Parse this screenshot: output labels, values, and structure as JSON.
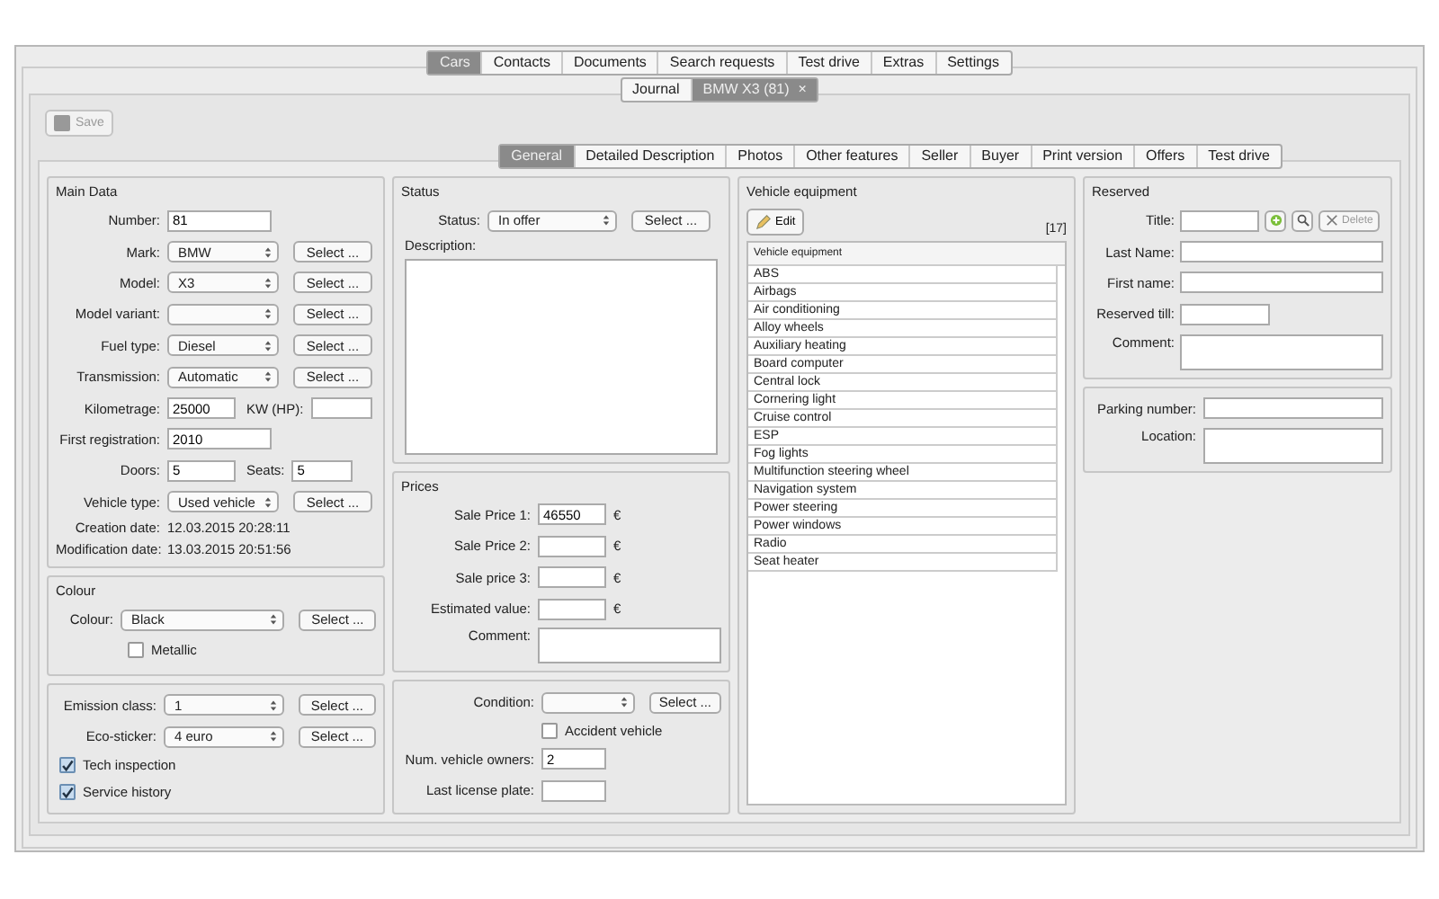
{
  "main_tabs": [
    {
      "label": "Cars",
      "selected": true
    },
    {
      "label": "Contacts",
      "selected": false
    },
    {
      "label": "Documents",
      "selected": false
    },
    {
      "label": "Search requests",
      "selected": false
    },
    {
      "label": "Test drive",
      "selected": false
    },
    {
      "label": "Extras",
      "selected": false
    },
    {
      "label": "Settings",
      "selected": false
    }
  ],
  "document_tabs": [
    {
      "label": "Journal",
      "selected": false
    },
    {
      "label": "BMW X3 (81)",
      "selected": true,
      "close": "×"
    }
  ],
  "save_button": {
    "label": "Save",
    "disabled": true
  },
  "section_tabs": [
    {
      "label": "General",
      "selected": true
    },
    {
      "label": "Detailed Description",
      "selected": false
    },
    {
      "label": "Photos",
      "selected": false
    },
    {
      "label": "Other features",
      "selected": false
    },
    {
      "label": "Seller",
      "selected": false
    },
    {
      "label": "Buyer",
      "selected": false
    },
    {
      "label": "Print version",
      "selected": false
    },
    {
      "label": "Offers",
      "selected": false
    },
    {
      "label": "Test drive",
      "selected": false
    }
  ],
  "main_data": {
    "title": "Main Data",
    "fields": [
      {
        "kind": "text",
        "label": "Number:",
        "value": "81"
      },
      {
        "kind": "select",
        "label": "Mark:",
        "value": "BMW",
        "button": "Select ..."
      },
      {
        "kind": "select",
        "label": "Model:",
        "value": "X3",
        "button": "Select ..."
      },
      {
        "kind": "select",
        "label": "Model variant:",
        "button": "Select ..."
      },
      {
        "kind": "select",
        "label": "Fuel type:",
        "value": "Diesel",
        "button": "Select ..."
      },
      {
        "kind": "select",
        "label": "Transmission:",
        "value": "Automatic",
        "button": "Select ..."
      },
      {
        "kind": "pair",
        "label": "Kilometrage:",
        "value": "25000",
        "label_2": "KW (HP):"
      },
      {
        "kind": "text",
        "label": "First registration:",
        "value": "2010"
      },
      {
        "kind": "pair",
        "label": "Doors:",
        "value": "5",
        "label_2": "Seats:",
        "value_2": "5"
      },
      {
        "kind": "select",
        "label": "Vehicle type:",
        "value": "Used vehicle",
        "button": "Select ..."
      },
      {
        "kind": "info",
        "label": "Creation date:",
        "value": "12.03.2015  20:28:11"
      },
      {
        "kind": "info",
        "label": "Modification date:",
        "value": "13.03.2015  20:51:56"
      }
    ]
  },
  "colour": {
    "title": "Colour",
    "fields": [
      {
        "kind": "select",
        "label": "Colour:",
        "value": "Black",
        "button": "Select ..."
      },
      {
        "kind": "checkbox",
        "label": "Metallic",
        "checked": false
      }
    ]
  },
  "emission": {
    "fields": [
      {
        "kind": "select",
        "label": "Emission class:",
        "value": "1",
        "button": "Select ..."
      },
      {
        "kind": "select",
        "label": "Eco-sticker:",
        "value": "4 euro",
        "button": "Select ..."
      },
      {
        "kind": "checkbox",
        "label": "Tech inspection",
        "checked": true
      },
      {
        "kind": "checkbox",
        "label": "Service history",
        "checked": true
      }
    ]
  },
  "status": {
    "title": "Status",
    "fields": [
      {
        "kind": "select",
        "label": "Status:",
        "value": "In offer",
        "button": "Select ..."
      },
      {
        "kind": "description",
        "label": "Description:"
      }
    ]
  },
  "prices": {
    "title": "Prices",
    "fields": [
      {
        "kind": "money",
        "label": "Sale Price 1:",
        "value": "46550",
        "unit": "€"
      },
      {
        "kind": "money",
        "label": "Sale Price 2:",
        "unit": "€"
      },
      {
        "kind": "money",
        "label": "Sale price 3:",
        "unit": "€"
      },
      {
        "kind": "money",
        "label": "Estimated value:",
        "unit": "€"
      },
      {
        "kind": "textarea",
        "label": "Comment:"
      }
    ]
  },
  "condition": {
    "fields": [
      {
        "kind": "select",
        "label": "Condition:",
        "button": "Select ..."
      },
      {
        "kind": "checkbox",
        "label": "Accident vehicle",
        "checked": false
      },
      {
        "kind": "text",
        "label": "Num. vehicle owners:",
        "value": "2"
      },
      {
        "kind": "text",
        "label": "Last license plate:"
      }
    ]
  },
  "vehicle_equipment": {
    "title": "Vehicle equipment",
    "edit_button": "Edit",
    "count": "[17]",
    "list_header": "Vehicle equipment",
    "items": [
      "ABS",
      "Airbags",
      "Air conditioning",
      "Alloy wheels",
      "Auxiliary heating",
      "Board computer",
      "Central lock",
      "Cornering light",
      "Cruise control",
      "ESP",
      "Fog lights",
      "Multifunction steering wheel",
      "Navigation system",
      "Power steering",
      "Power windows",
      "Radio",
      "Seat heater"
    ]
  },
  "reserved": {
    "title": "Reserved",
    "fields": [
      {
        "kind": "lookup",
        "label": "Title:",
        "delete_button": {
          "label": "Delete",
          "disabled": true
        }
      },
      {
        "kind": "wide",
        "label": "Last Name:"
      },
      {
        "kind": "wide",
        "label": "First name:"
      },
      {
        "kind": "text",
        "label": "Reserved till:"
      },
      {
        "kind": "textarea",
        "label": "Comment:"
      }
    ]
  },
  "parking": {
    "fields": [
      {
        "kind": "wide",
        "label": "Parking number:"
      },
      {
        "kind": "textarea",
        "label": "Location:"
      }
    ]
  }
}
